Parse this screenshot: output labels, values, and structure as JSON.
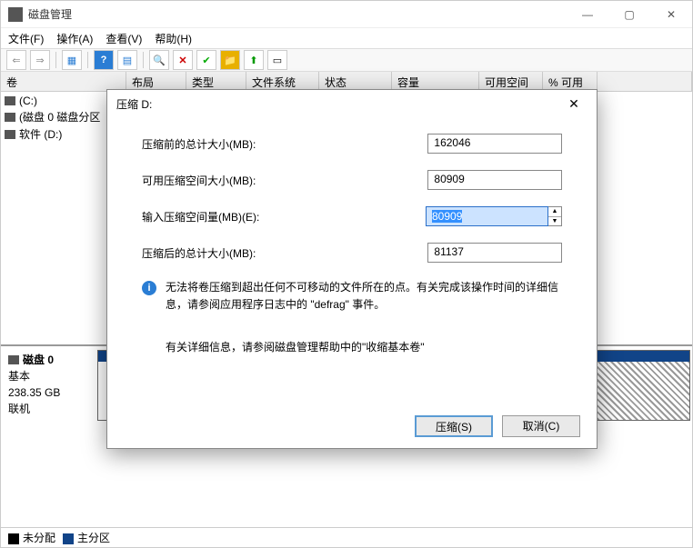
{
  "window": {
    "title": "磁盘管理"
  },
  "menus": {
    "file": "文件(F)",
    "action": "操作(A)",
    "view": "查看(V)",
    "help": "帮助(H)"
  },
  "columns": {
    "volume": "卷",
    "layout": "布局",
    "type": "类型",
    "fs": "文件系统",
    "status": "状态",
    "capacity": "容量",
    "free": "可用空间",
    "percent": "% 可用"
  },
  "volumes": [
    {
      "label": "(C:)"
    },
    {
      "label": "(磁盘 0 磁盘分区"
    },
    {
      "label": "软件 (D:)"
    }
  ],
  "disk": {
    "title": "磁盘 0",
    "type": "基本",
    "size": "238.35 GB",
    "status": "联机"
  },
  "legend": {
    "unalloc": "未分配",
    "primary": "主分区"
  },
  "dialog": {
    "title": "压缩 D:",
    "label_before": "压缩前的总计大小(MB):",
    "val_before": "162046",
    "label_avail": "可用压缩空间大小(MB):",
    "val_avail": "80909",
    "label_input": "输入压缩空间量(MB)(E):",
    "val_input": "80909",
    "label_after": "压缩后的总计大小(MB):",
    "val_after": "81137",
    "info": "无法将卷压缩到超出任何不可移动的文件所在的点。有关完成该操作时间的详细信息，请参阅应用程序日志中的 \"defrag\" 事件。",
    "help_text": "有关详细信息，请参阅磁盘管理帮助中的\"收缩基本卷\"",
    "btn_shrink": "压缩(S)",
    "btn_cancel": "取消(C)"
  }
}
